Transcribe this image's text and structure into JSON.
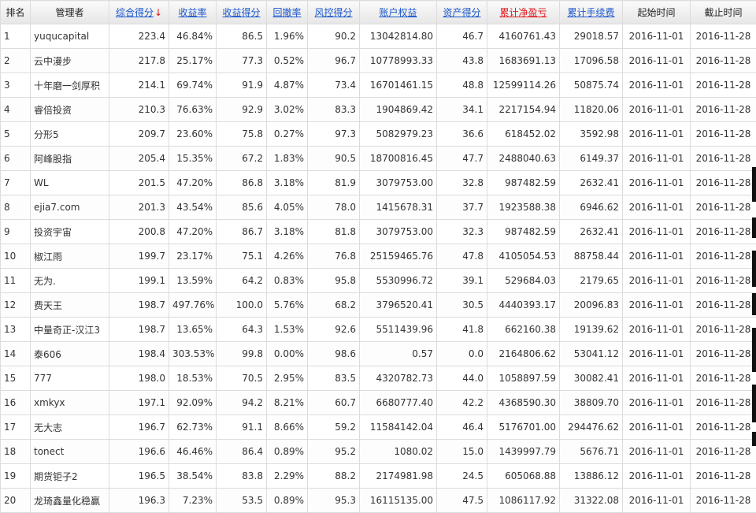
{
  "table": {
    "columns": [
      {
        "key": "rank",
        "label": "排名",
        "sortable": false
      },
      {
        "key": "manager",
        "label": "管理者",
        "sortable": false
      },
      {
        "key": "total_score",
        "label": "综合得分",
        "sortable": true,
        "red": false,
        "arrow": "↓"
      },
      {
        "key": "return_rate",
        "label": "收益率",
        "sortable": true,
        "red": false,
        "arrow": ""
      },
      {
        "key": "return_score",
        "label": "收益得分",
        "sortable": true,
        "red": false,
        "arrow": ""
      },
      {
        "key": "drawdown",
        "label": "回撤率",
        "sortable": true,
        "red": false,
        "arrow": ""
      },
      {
        "key": "risk_score",
        "label": "风控得分",
        "sortable": true,
        "red": false,
        "arrow": ""
      },
      {
        "key": "equity",
        "label": "账户权益",
        "sortable": true,
        "red": false,
        "arrow": ""
      },
      {
        "key": "asset_score",
        "label": "资产得分",
        "sortable": true,
        "red": false,
        "arrow": ""
      },
      {
        "key": "net_pnl",
        "label": "累计净盈亏",
        "sortable": true,
        "red": true,
        "arrow": ""
      },
      {
        "key": "fees",
        "label": "累计手续费",
        "sortable": true,
        "red": false,
        "arrow": ""
      },
      {
        "key": "start",
        "label": "起始时间",
        "sortable": false
      },
      {
        "key": "end",
        "label": "截止时间",
        "sortable": false
      }
    ],
    "rows": [
      [
        "1",
        "yuqucapital",
        "223.4",
        "46.84%",
        "86.5",
        "1.96%",
        "90.2",
        "13042814.80",
        "46.7",
        "4160761.43",
        "29018.57",
        "2016-11-01",
        "2016-11-28"
      ],
      [
        "2",
        "云中漫步",
        "217.8",
        "25.17%",
        "77.3",
        "0.52%",
        "96.7",
        "10778993.33",
        "43.8",
        "1683691.13",
        "17096.58",
        "2016-11-01",
        "2016-11-28"
      ],
      [
        "3",
        "十年磨一剑厚积",
        "214.1",
        "69.74%",
        "91.9",
        "4.87%",
        "73.4",
        "16701461.15",
        "48.8",
        "12599114.26",
        "50875.74",
        "2016-11-01",
        "2016-11-28"
      ],
      [
        "4",
        "睿倍投资",
        "210.3",
        "76.63%",
        "92.9",
        "3.02%",
        "83.3",
        "1904869.42",
        "34.1",
        "2217154.94",
        "11820.06",
        "2016-11-01",
        "2016-11-28"
      ],
      [
        "5",
        "分形5",
        "209.7",
        "23.60%",
        "75.8",
        "0.27%",
        "97.3",
        "5082979.23",
        "36.6",
        "618452.02",
        "3592.98",
        "2016-11-01",
        "2016-11-28"
      ],
      [
        "6",
        "阿峰股指",
        "205.4",
        "15.35%",
        "67.2",
        "1.83%",
        "90.5",
        "18700816.45",
        "47.7",
        "2488040.63",
        "6149.37",
        "2016-11-01",
        "2016-11-28"
      ],
      [
        "7",
        "WL",
        "201.5",
        "47.20%",
        "86.8",
        "3.18%",
        "81.9",
        "3079753.00",
        "32.8",
        "987482.59",
        "2632.41",
        "2016-11-01",
        "2016-11-28"
      ],
      [
        "8",
        "ejia7.com",
        "201.3",
        "43.54%",
        "85.6",
        "4.05%",
        "78.0",
        "1415678.31",
        "37.7",
        "1923588.38",
        "6946.62",
        "2016-11-01",
        "2016-11-28"
      ],
      [
        "9",
        "投资宇宙",
        "200.8",
        "47.20%",
        "86.7",
        "3.18%",
        "81.8",
        "3079753.00",
        "32.3",
        "987482.59",
        "2632.41",
        "2016-11-01",
        "2016-11-28"
      ],
      [
        "10",
        "椒江雨",
        "199.7",
        "23.17%",
        "75.1",
        "4.26%",
        "76.8",
        "25159465.76",
        "47.8",
        "4105054.53",
        "88758.44",
        "2016-11-01",
        "2016-11-28"
      ],
      [
        "11",
        "无为.",
        "199.1",
        "13.59%",
        "64.2",
        "0.83%",
        "95.8",
        "5530996.72",
        "39.1",
        "529684.03",
        "2179.65",
        "2016-11-01",
        "2016-11-28"
      ],
      [
        "12",
        "费天王",
        "198.7",
        "497.76%",
        "100.0",
        "5.76%",
        "68.2",
        "3796520.41",
        "30.5",
        "4440393.17",
        "20096.83",
        "2016-11-01",
        "2016-11-28"
      ],
      [
        "13",
        "中量奇正-汉江3",
        "198.7",
        "13.65%",
        "64.3",
        "1.53%",
        "92.6",
        "5511439.96",
        "41.8",
        "662160.38",
        "19139.62",
        "2016-11-01",
        "2016-11-28"
      ],
      [
        "14",
        "泰606",
        "198.4",
        "303.53%",
        "99.8",
        "0.00%",
        "98.6",
        "0.57",
        "0.0",
        "2164806.62",
        "53041.12",
        "2016-11-01",
        "2016-11-28"
      ],
      [
        "15",
        "777",
        "198.0",
        "18.53%",
        "70.5",
        "2.95%",
        "83.5",
        "4320782.73",
        "44.0",
        "1058897.59",
        "30082.41",
        "2016-11-01",
        "2016-11-28"
      ],
      [
        "16",
        "xmkyx",
        "197.1",
        "92.09%",
        "94.2",
        "8.21%",
        "60.7",
        "6680777.40",
        "42.2",
        "4368590.30",
        "38809.70",
        "2016-11-01",
        "2016-11-28"
      ],
      [
        "17",
        "无大志",
        "196.7",
        "62.73%",
        "91.1",
        "8.66%",
        "59.2",
        "11584142.04",
        "46.4",
        "5176701.00",
        "294476.62",
        "2016-11-01",
        "2016-11-28"
      ],
      [
        "18",
        "tonect",
        "196.6",
        "46.46%",
        "86.4",
        "0.89%",
        "95.2",
        "1080.02",
        "15.0",
        "1439997.79",
        "5676.71",
        "2016-11-01",
        "2016-11-28"
      ],
      [
        "19",
        "期货钜子2",
        "196.5",
        "38.54%",
        "83.8",
        "2.29%",
        "88.2",
        "2174981.98",
        "24.5",
        "605068.88",
        "13886.12",
        "2016-11-01",
        "2016-11-28"
      ],
      [
        "20",
        "龙琦鑫量化稳赢",
        "196.3",
        "7.23%",
        "53.5",
        "0.89%",
        "95.3",
        "16115135.00",
        "47.5",
        "1086117.92",
        "31322.08",
        "2016-11-01",
        "2016-11-28"
      ]
    ]
  },
  "colors": {
    "link": "#1a56cc",
    "highlight": "#e0191f",
    "text": "#333333",
    "border": "#dcdcdc"
  }
}
